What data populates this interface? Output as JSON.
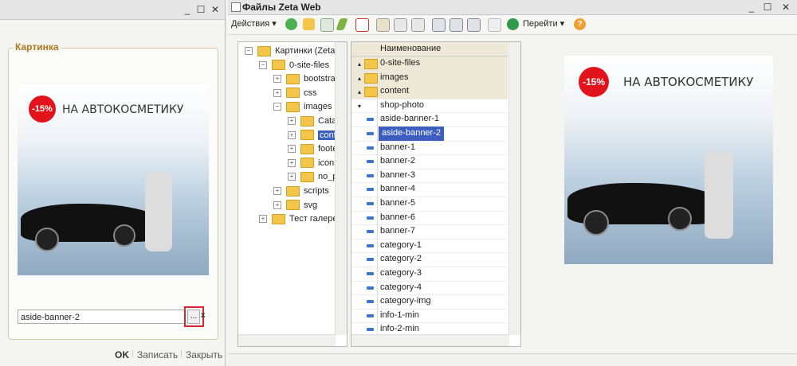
{
  "left_window": {
    "group_title": "Картинка",
    "banner": {
      "badge": "-15%",
      "text": "НА АВТОКОСМЕТИКУ"
    },
    "file_input_value": "aside-banner-2",
    "pick_label": "...",
    "clear_label": "x",
    "footer": {
      "ok": "OK",
      "save": "Записать",
      "close": "Закрыть"
    },
    "title_buttons": {
      "min": "_",
      "max": "☐",
      "close": "✕"
    }
  },
  "right_window": {
    "title": "Файлы Zeta Web",
    "title_buttons": {
      "min": "_",
      "max": "☐",
      "close": "✕"
    },
    "toolbar": {
      "actions": "Действия ▾",
      "navigate": "Перейти ▾",
      "help": "?"
    },
    "tree": [
      {
        "label": "Картинки (Zeta",
        "level": 0,
        "pm": "⊖"
      },
      {
        "label": "0-site-files",
        "level": 1,
        "pm": "⊖"
      },
      {
        "label": "bootstrap",
        "level": 2,
        "pm": "⊕"
      },
      {
        "label": "css",
        "level": 2,
        "pm": "⊕"
      },
      {
        "label": "images",
        "level": 2,
        "pm": "⊖"
      },
      {
        "label": "Cata",
        "level": 3,
        "pm": "⊕"
      },
      {
        "label": "conte",
        "level": 3,
        "pm": "⊕",
        "selected": true
      },
      {
        "label": "foote",
        "level": 3,
        "pm": "⊕"
      },
      {
        "label": "icons",
        "level": 3,
        "pm": "⊕"
      },
      {
        "label": "no_p",
        "level": 3,
        "pm": "⊕"
      },
      {
        "label": "scripts",
        "level": 2,
        "pm": "⊕"
      },
      {
        "label": "svg",
        "level": 2,
        "pm": "⊕"
      },
      {
        "label": "Тест галере",
        "level": 1,
        "pm": "⊕"
      }
    ],
    "list_header": "Наименование",
    "list": [
      {
        "name": "0-site-files",
        "type": "dir-up"
      },
      {
        "name": "images",
        "type": "dir"
      },
      {
        "name": "content",
        "type": "dir"
      },
      {
        "name": "shop-photo",
        "type": "subdir"
      },
      {
        "name": "aside-banner-1",
        "type": "file"
      },
      {
        "name": "aside-banner-2",
        "type": "file",
        "selected": true
      },
      {
        "name": "banner-1",
        "type": "file"
      },
      {
        "name": "banner-2",
        "type": "file"
      },
      {
        "name": "banner-3",
        "type": "file"
      },
      {
        "name": "banner-4",
        "type": "file"
      },
      {
        "name": "banner-5",
        "type": "file"
      },
      {
        "name": "banner-6",
        "type": "file"
      },
      {
        "name": "banner-7",
        "type": "file"
      },
      {
        "name": "category-1",
        "type": "file"
      },
      {
        "name": "category-2",
        "type": "file"
      },
      {
        "name": "category-3",
        "type": "file"
      },
      {
        "name": "category-4",
        "type": "file"
      },
      {
        "name": "category-img",
        "type": "file"
      },
      {
        "name": "info-1-min",
        "type": "file"
      },
      {
        "name": "info-2-min",
        "type": "file"
      }
    ],
    "preview_banner": {
      "badge": "-15%",
      "text": "НА АВТОКОСМЕТИКУ"
    }
  },
  "colors": {
    "selection": "#3b5ec0",
    "folder": "#f2c54b",
    "accent_title": "#b0781c",
    "badge_red": "#e3131b"
  }
}
